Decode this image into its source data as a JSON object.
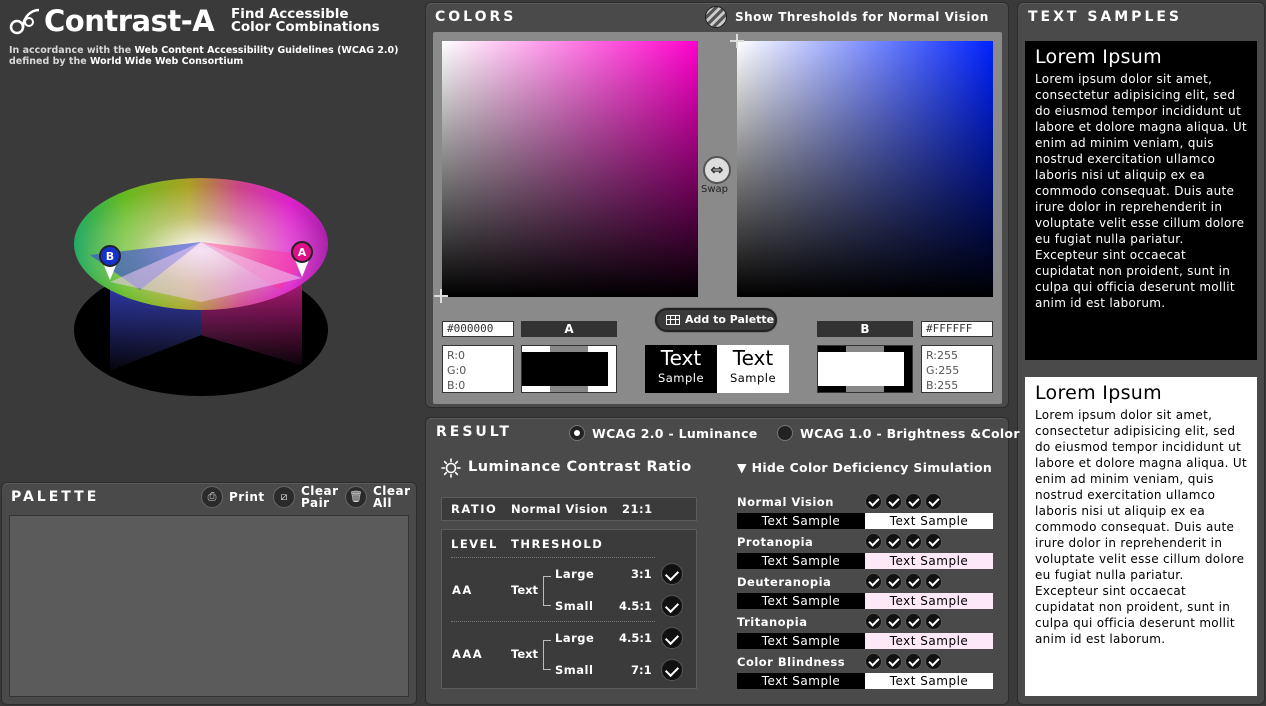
{
  "header": {
    "title": "Contrast-A",
    "tagline_line1": "Find Accessible",
    "tagline_line2": "Color Combinations",
    "subtitle_pre1": "In accordance with the ",
    "subtitle_b1": "Web Content Accessibility Guidelines (WCAG 2.0)",
    "subtitle_pre2": "defined by the ",
    "subtitle_b2": "World Wide Web Consortium"
  },
  "wheel": {
    "marker_a": "A",
    "marker_b": "B"
  },
  "colors": {
    "title": "COLORS",
    "show_thresholds_label": "Show Thresholds for Normal Vision",
    "swap_label": "Swap",
    "add_to_palette_label": "Add to Palette",
    "color_a": {
      "label": "A",
      "hex": "#000000",
      "r": "R:0",
      "g": "G:0",
      "b": "B:0",
      "value": "#000000"
    },
    "color_b": {
      "label": "B",
      "hex": "#FFFFFF",
      "r": "R:255",
      "g": "G:255",
      "b": "B:255",
      "value": "#FFFFFF"
    },
    "sample_big": "Text",
    "sample_small": "Sample"
  },
  "text_samples": {
    "title": "TEXT SAMPLES",
    "heading": "Lorem Ipsum",
    "body": "Lorem ipsum dolor sit amet, consectetur adipisicing elit, sed do eiusmod tempor incididunt ut labore et dolore magna aliqua. Ut enim ad minim veniam, quis nostrud exercitation ullamco laboris nisi ut aliquip ex ea commodo consequat. Duis aute irure dolor in reprehenderit in voluptate velit esse cillum dolore eu fugiat nulla pariatur. Excepteur sint occaecat cupidatat non proident, sunt in culpa qui officia deserunt mollit anim id est laborum."
  },
  "palette": {
    "title": "PALETTE",
    "print_label": "Print",
    "clear_pair_line1": "Clear",
    "clear_pair_line2": "Pair",
    "clear_all_line1": "Clear",
    "clear_all_line2": "All"
  },
  "result": {
    "title": "RESULT",
    "mode_wcag2": "WCAG 2.0 - Luminance",
    "mode_wcag1": "WCAG 1.0 - Brightness &Color",
    "selected_mode": "WCAG 2.0 - Luminance",
    "luminance_title": "Luminance Contrast Ratio",
    "ratio_label": "RATIO",
    "ratio_vision": "Normal Vision",
    "ratio_value": "21:1",
    "level_header": "LEVEL",
    "threshold_header": "THRESHOLD",
    "levels": [
      {
        "level": "AA",
        "text": "Text",
        "large_label": "Large",
        "large_value": "3:1",
        "small_label": "Small",
        "small_value": "4.5:1"
      },
      {
        "level": "AAA",
        "text": "Text",
        "large_label": "Large",
        "large_value": "4.5:1",
        "small_label": "Small",
        "small_value": "7:1"
      }
    ],
    "cvd_toggle": "▼ Hide Color Deficiency Simulation",
    "cvd": [
      {
        "name": "Normal Vision",
        "sample": "Text Sample",
        "light_color": "#ffffff"
      },
      {
        "name": "Protanopia",
        "sample": "Text Sample",
        "light_color": "#fde8f8"
      },
      {
        "name": "Deuteranopia",
        "sample": "Text Sample",
        "light_color": "#fde8f8"
      },
      {
        "name": "Tritanopia",
        "sample": "Text Sample",
        "light_color": "#fde8f8"
      },
      {
        "name": "Color Blindness",
        "sample": "Text Sample",
        "light_color": "#ffffff"
      }
    ]
  },
  "icons": {
    "logo": "contrast-a-logo-icon",
    "thresholds": "thresholds-globe-icon",
    "swap": "swap-arrows-icon",
    "add": "grid-icon",
    "print": "printer-icon",
    "clear_pair": "clear-pair-icon",
    "clear_all": "trash-icon",
    "sun": "sun-icon",
    "check": "check-icon"
  }
}
